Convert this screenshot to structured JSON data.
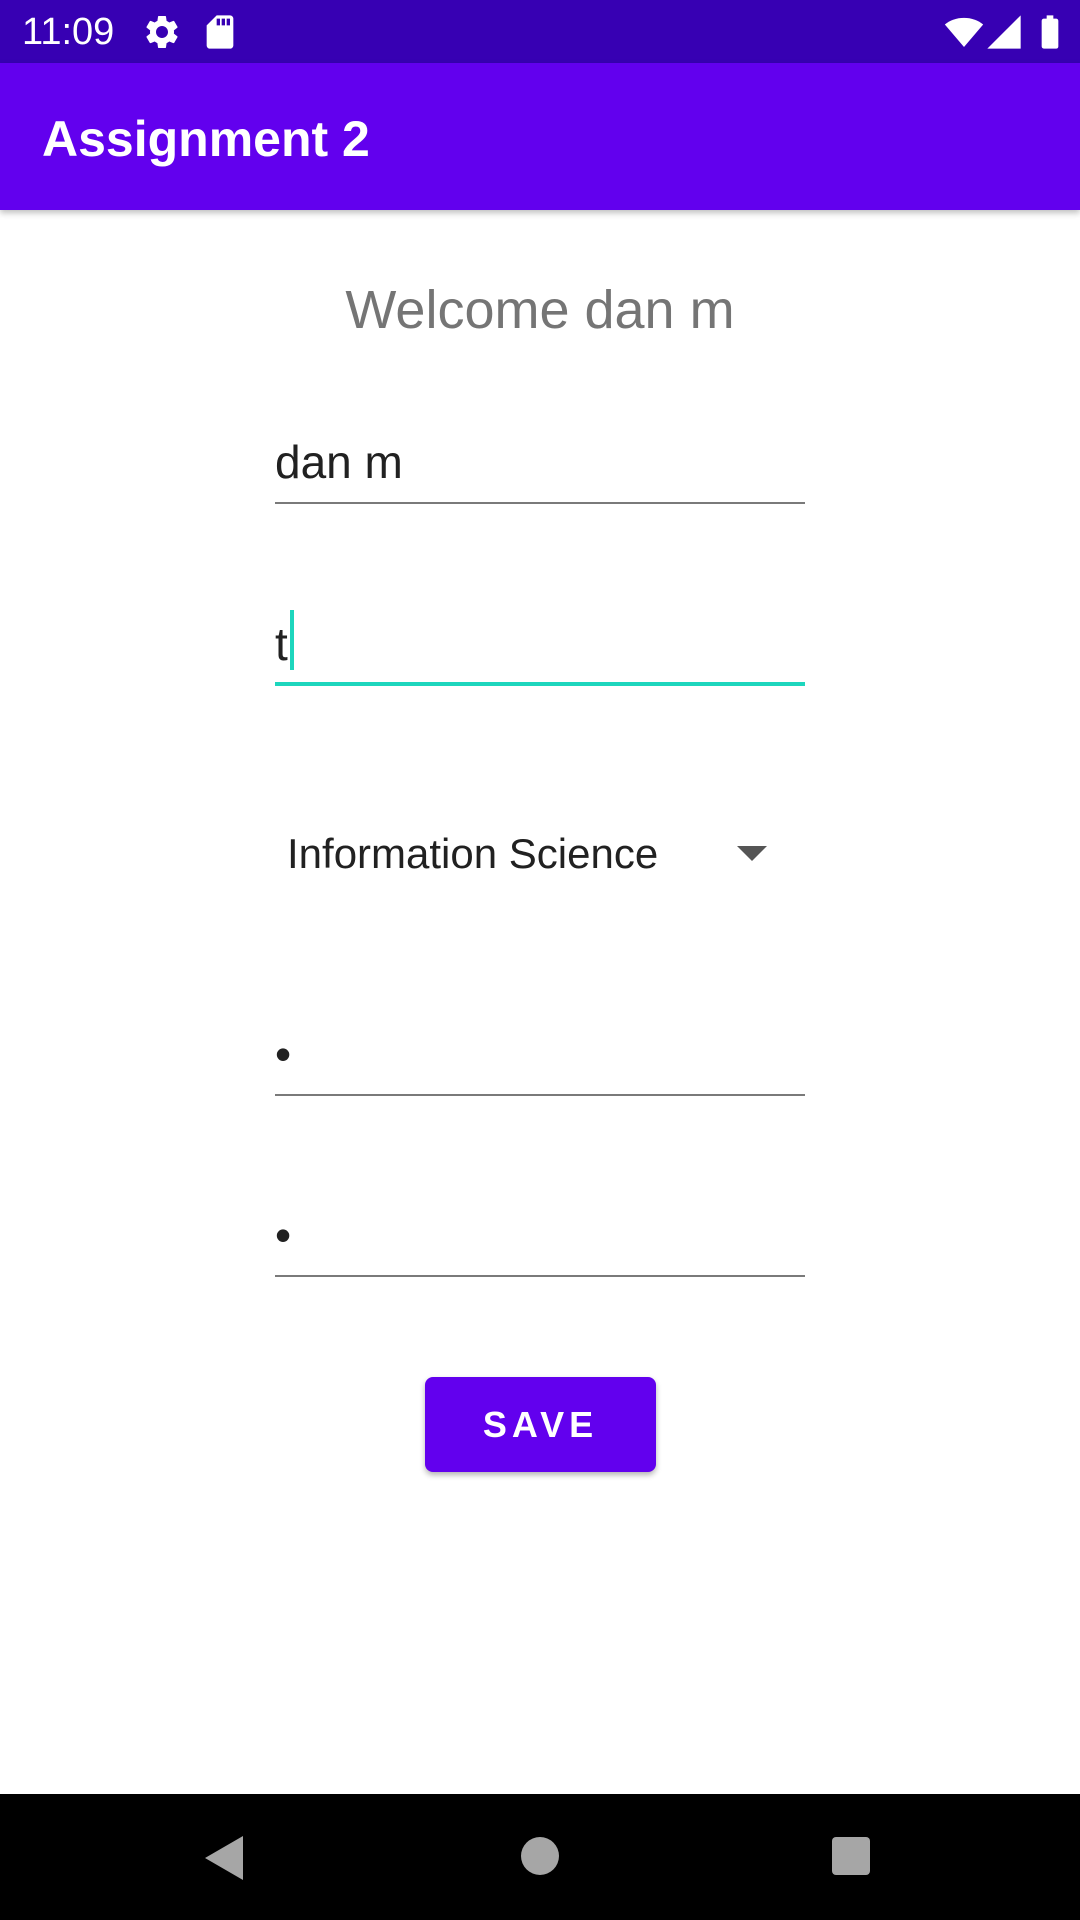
{
  "status_bar": {
    "time": "11:09",
    "icons": [
      "settings-icon",
      "sd-card-icon",
      "wifi-icon",
      "cell-signal-icon",
      "battery-icon"
    ]
  },
  "app_bar": {
    "title": "Assignment 2",
    "color": "#6200ee"
  },
  "main": {
    "welcome_text": "Welcome dan m",
    "name_field": {
      "value": "dan m"
    },
    "second_field": {
      "value": "t"
    },
    "major_spinner": {
      "selected": "Information Science"
    },
    "password_field": {
      "value": "•"
    },
    "confirm_password_field": {
      "value": "•"
    },
    "save_button": {
      "label": "SAVE"
    }
  },
  "colors": {
    "primary": "#6200ee",
    "primary_dark": "#3700b3",
    "focus_accent": "#1dd6bd"
  },
  "nav_bar": {
    "icons": [
      "back-icon",
      "home-icon",
      "recents-icon"
    ]
  }
}
